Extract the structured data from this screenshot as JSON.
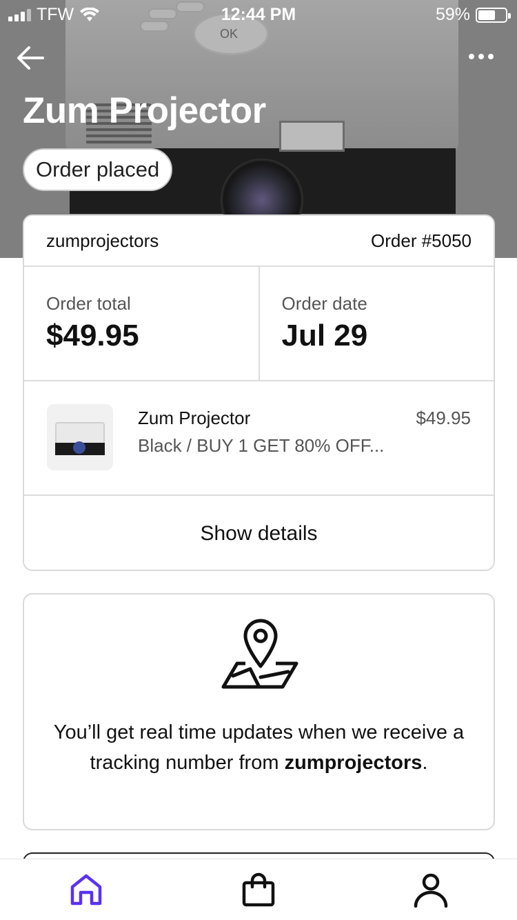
{
  "status_bar": {
    "carrier": "TFW",
    "time": "12:44 PM",
    "battery": "59%"
  },
  "hero": {
    "title": "Zum Projector",
    "status_pill": "Order placed",
    "dial_label": "OK"
  },
  "order": {
    "store": "zumprojectors",
    "order_number": "Order #5050",
    "total_label": "Order total",
    "total_value": "$49.95",
    "date_label": "Order date",
    "date_value": "Jul 29",
    "item": {
      "name": "Zum Projector",
      "variant": "Black / BUY 1 GET 80% OFF...",
      "price": "$49.95"
    },
    "show_details_label": "Show details"
  },
  "tracking": {
    "text_before": "You’ll get real time updates when we receive a tracking number from",
    "store": "zumprojectors",
    "text_after": "."
  },
  "colors": {
    "accent": "#5a31f4",
    "text": "#111111",
    "muted": "#555555",
    "border": "#d9d9d9"
  },
  "icons": {
    "back": "arrow-left-icon",
    "more": "more-horizontal-icon",
    "tracking": "map-pin-icon",
    "home": "home-icon",
    "shop": "shopping-bag-icon",
    "account": "user-icon"
  }
}
